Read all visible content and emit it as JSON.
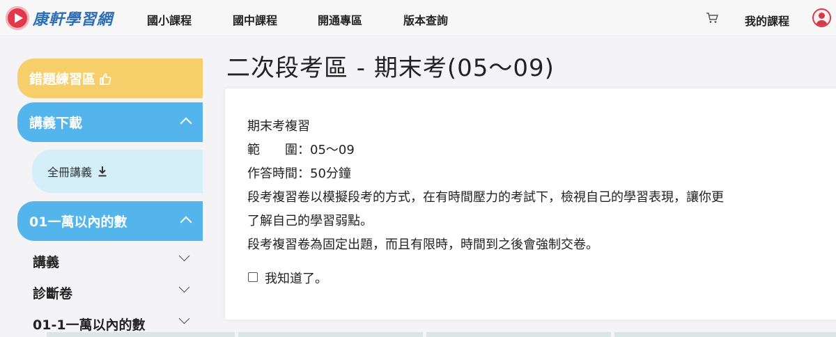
{
  "header": {
    "brand": "康軒學習網",
    "nav": [
      "國小課程",
      "國中課程",
      "開通專區",
      "版本查詢"
    ],
    "my_courses": "我的課程"
  },
  "sidebar": {
    "mistake_practice": "錯題練習區",
    "handout_download": "講義下載",
    "full_handout": "全冊講義",
    "chapter": "01一萬以內的數",
    "items": [
      "講義",
      "診斷卷",
      "01-1一萬以內的數"
    ]
  },
  "main": {
    "title": "二次段考區 - 期末考(05～09)",
    "lines": [
      "期末考複習",
      "範　　圍：05～09",
      "作答時間：50分鐘",
      "段考複習卷以模擬段考的方式，在有時間壓力的考試下，檢視自己的學習表現，讓你更",
      "了解自己的學習弱點。",
      "段考複習卷為固定出題，而且有限時，時間到之後會強制交卷。"
    ],
    "acknowledge": "我知道了。"
  },
  "colors": {
    "yellow_pill": "#f7cf6a",
    "blue_pill": "#54b5ec",
    "light_blue_pill": "#d5eff9",
    "brand_red": "#e2384a",
    "brand_blue": "#2d6fb6"
  },
  "icons": {
    "thumbs_up": "thumbs-up-icon",
    "download": "download-icon",
    "cart": "cart-icon",
    "user": "user-icon"
  }
}
